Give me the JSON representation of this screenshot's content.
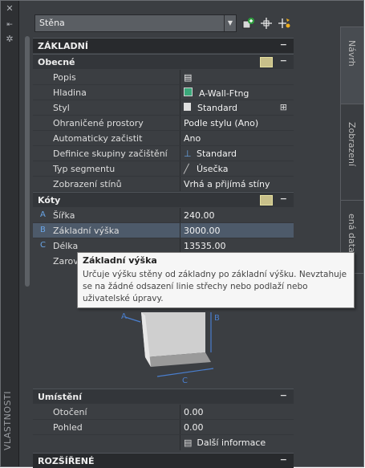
{
  "palette": {
    "title": "VLASTNOSTI",
    "object_type": "Stěna"
  },
  "tabs": [
    {
      "label": "Návrh"
    },
    {
      "label": "Zobrazení"
    },
    {
      "label": "ená data"
    }
  ],
  "sections": {
    "zakladni": {
      "label": "ZÁKLADNÍ"
    },
    "obecne": {
      "label": "Obecné"
    },
    "koty": {
      "label": "Kóty"
    },
    "umisteni": {
      "label": "Umístění"
    },
    "rozsirene": {
      "label": "ROZŠÍŘENÉ"
    }
  },
  "general": {
    "rows": [
      {
        "label": "Popis",
        "value": ""
      },
      {
        "label": "Hladina",
        "value": "A-Wall-Ftng"
      },
      {
        "label": "Styl",
        "value": "Standard"
      },
      {
        "label": "Ohraničené prostory",
        "value": "Podle stylu (Ano)"
      },
      {
        "label": "Automaticky začistit",
        "value": "Ano"
      },
      {
        "label": "Definice skupiny začištění",
        "value": "Standard"
      },
      {
        "label": "Typ segmentu",
        "value": "Úsečka"
      },
      {
        "label": "Zobrazení stínů",
        "value": "Vrhá a přijímá stíny"
      }
    ]
  },
  "dimensions": {
    "rows": [
      {
        "key": "A",
        "label": "Šířka",
        "value": "240.00"
      },
      {
        "key": "B",
        "label": "Základní výška",
        "value": "3000.00"
      },
      {
        "key": "C",
        "label": "Délka",
        "value": "13535.00"
      },
      {
        "key": "",
        "label": "Zarov",
        "value": ""
      }
    ],
    "diagram_letters": [
      "A",
      "B",
      "C"
    ]
  },
  "placement": {
    "rows": [
      {
        "label": "Otočení",
        "value": "0.00"
      },
      {
        "label": "Pohled",
        "value": "0.00"
      }
    ],
    "more_info": "Další informace"
  },
  "tooltip": {
    "title": "Základní výška",
    "description": "Určuje výšku stěny od základny po základní výšku. Nevztahuje se na žádné odsazení linie střechy nebo podlaží nebo uživatelské úpravy."
  },
  "colors": {
    "panel": "#3b3e42",
    "section": "#282a2d",
    "key": "#6aa6e8",
    "tooltip_bg": "#f6f6f6"
  }
}
